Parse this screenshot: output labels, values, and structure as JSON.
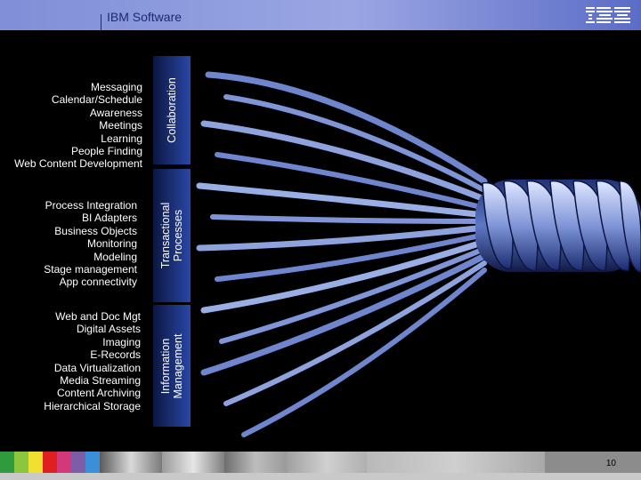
{
  "header": {
    "title": "IBM Software",
    "logo": "IBM"
  },
  "collaboration": {
    "label": "Collaboration",
    "items": [
      "Messaging",
      "Calendar/Schedule",
      "Awareness",
      "Meetings",
      "Learning",
      "People Finding",
      "Web Content Development"
    ]
  },
  "transactional": {
    "label_line1": "Transactional",
    "label_line2": "Processes",
    "items": [
      "Process Integration",
      "BI Adapters",
      "Business Objects",
      "Monitoring",
      "Modeling",
      "Stage management",
      "App connectivity"
    ]
  },
  "information": {
    "label_line1": "Information",
    "label_line2": "Management",
    "items": [
      "Web and Doc Mgt",
      "Digital Assets",
      "Imaging",
      "E-Records",
      "Data Virtualization",
      "Media Streaming",
      "Content Archiving",
      "Hierarchical Storage"
    ]
  },
  "footer": {
    "page_number": "10",
    "swatch_colors": [
      "#2f9b3c",
      "#8cc63f",
      "#f0e030",
      "#e02020",
      "#d2387a",
      "#7d5ca8",
      "#3a8fd8"
    ]
  },
  "colors": {
    "header": "#8f9de0",
    "panel": "#223a8e",
    "rope": "#7f95d8"
  }
}
